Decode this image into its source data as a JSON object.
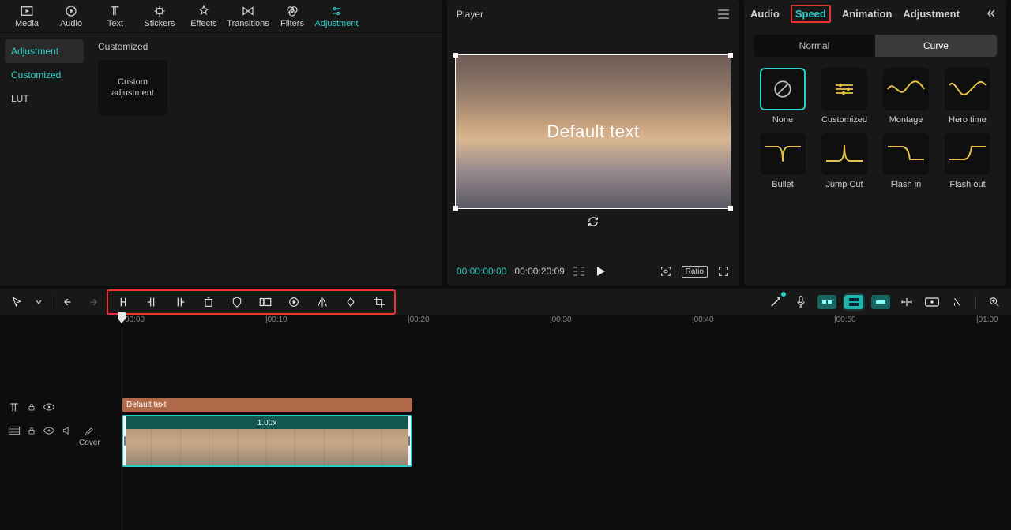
{
  "mediaTabs": [
    "Media",
    "Audio",
    "Text",
    "Stickers",
    "Effects",
    "Transitions",
    "Filters",
    "Adjustment"
  ],
  "activeMediaTab": "Adjustment",
  "sideItems": {
    "adjustment": "Adjustment",
    "customized": "Customized",
    "lut": "LUT"
  },
  "sectionTitle": "Customized",
  "cardLabel": "Custom adjustment",
  "player": {
    "title": "Player",
    "canvasText": "Default text",
    "timeCur": "00:00:00:00",
    "timeDur": "00:00:20:09",
    "ratio": "Ratio"
  },
  "rightTabs": {
    "audio": "Audio",
    "speed": "Speed",
    "animation": "Animation",
    "adjustment": "Adjustment"
  },
  "pills": {
    "normal": "Normal",
    "curve": "Curve"
  },
  "presets": {
    "none": "None",
    "customized": "Customized",
    "montage": "Montage",
    "hero": "Hero time",
    "bullet": "Bullet",
    "jump": "Jump Cut",
    "flashin": "Flash in",
    "flashout": "Flash out"
  },
  "ruler": {
    "t0": "00:00",
    "t10": "|00:10",
    "t20": "|00:20",
    "t30": "|00:30",
    "t40": "|00:40",
    "t50": "|00:50",
    "t60": "|01:00"
  },
  "clip": {
    "textLabel": "Default text",
    "speed": "1.00x",
    "cover": "Cover"
  }
}
